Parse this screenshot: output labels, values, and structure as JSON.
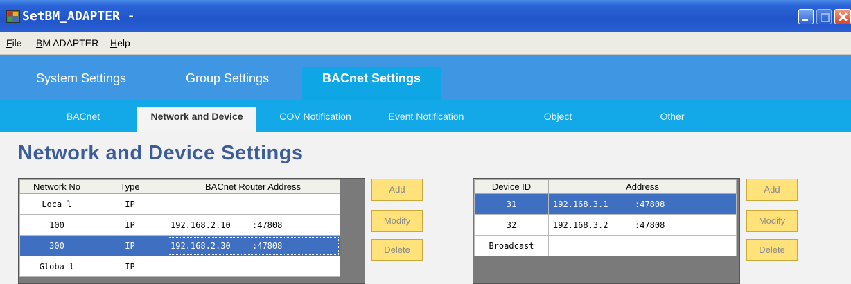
{
  "window": {
    "title": "SetBM_ADAPTER -"
  },
  "menu": [
    {
      "label": "File",
      "accel": "F",
      "rest": "ile"
    },
    {
      "label": "BM ADAPTER",
      "accel": "B",
      "rest": "M ADAPTER"
    },
    {
      "label": "Help",
      "accel": "H",
      "rest": "elp"
    }
  ],
  "main_tabs": [
    {
      "label": "System Settings",
      "active": false
    },
    {
      "label": "Group Settings",
      "active": false
    },
    {
      "label": "BACnet Settings",
      "active": true
    }
  ],
  "sub_tabs": [
    {
      "label": "BACnet",
      "active": false
    },
    {
      "label": "Network and Device",
      "active": true
    },
    {
      "label": "COV Notification",
      "active": false
    },
    {
      "label": "Event Notification",
      "active": false
    },
    {
      "label": "Object",
      "active": false
    },
    {
      "label": "Other",
      "active": false
    }
  ],
  "page": {
    "title": "Network and Device Settings"
  },
  "network_table": {
    "headers": [
      "Network No",
      "Type",
      "BACnet Router Address"
    ],
    "rows": [
      {
        "no": "Loca l",
        "type": "IP",
        "ip": "",
        "port": "",
        "selected": false
      },
      {
        "no": "100",
        "type": "IP",
        "ip": "192.168.2.10",
        "port": ":47808",
        "selected": false
      },
      {
        "no": "300",
        "type": "IP",
        "ip": "192.168.2.30",
        "port": ":47808",
        "selected": true
      },
      {
        "no": "Globa l",
        "type": "IP",
        "ip": "",
        "port": "",
        "selected": false
      }
    ]
  },
  "device_table": {
    "headers": [
      "Device ID",
      "Address"
    ],
    "rows": [
      {
        "id": "31",
        "ip": "192.168.3.1",
        "port": ":47808",
        "selected": true
      },
      {
        "id": "32",
        "ip": "192.168.3.2",
        "port": ":47808",
        "selected": false
      },
      {
        "id": "Broadcast",
        "ip": "",
        "port": "",
        "selected": false
      }
    ]
  },
  "buttons": {
    "add": "Add",
    "modify": "Modify",
    "delete": "Delete"
  },
  "colors": {
    "titlebar": "#1f55c8",
    "main_tab_strip": "#3f96e3",
    "sub_tab_strip": "#13a8e8",
    "selection": "#3f6fc0",
    "button_bg": "#ffe37a",
    "heading": "#3d5d9a"
  }
}
